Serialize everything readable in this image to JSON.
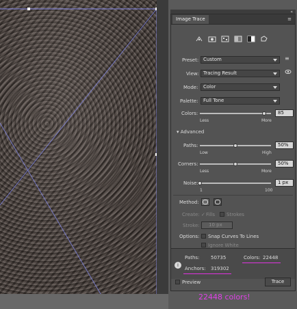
{
  "panel": {
    "tab_title": "Image Trace",
    "collapse_glyph": "«",
    "menu_glyph": "≡",
    "preset_icons": [
      "auto-color-icon",
      "high-color-icon",
      "low-color-icon",
      "grayscale-icon",
      "black-white-icon",
      "outline-icon"
    ]
  },
  "preset": {
    "label": "Preset:",
    "value": "Custom"
  },
  "view": {
    "label": "View:",
    "value": "Tracing Result"
  },
  "mode": {
    "label": "Mode:",
    "value": "Color"
  },
  "palette": {
    "label": "Palette:",
    "value": "Full Tone"
  },
  "colors": {
    "label": "Colors:",
    "value": "85",
    "min_label": "Less",
    "max_label": "More",
    "level": 0.9
  },
  "advanced": {
    "label": "Advanced"
  },
  "paths": {
    "label": "Paths:",
    "value": "50%",
    "min_label": "Low",
    "max_label": "High",
    "level": 0.5
  },
  "corners": {
    "label": "Corners:",
    "value": "50%",
    "min_label": "Less",
    "max_label": "More",
    "level": 0.5
  },
  "noise": {
    "label": "Noise:",
    "value": "1 px",
    "min_label": "1",
    "max_label": "100",
    "level": 0.0
  },
  "method": {
    "label": "Method:"
  },
  "create": {
    "label": "Create:",
    "fills": "Fills",
    "strokes": "Strokes"
  },
  "stroke": {
    "label": "Stroke:",
    "value": "10 px"
  },
  "options": {
    "label": "Options:",
    "snap": "Snap Curves To Lines",
    "ignore_white": "Ignore White"
  },
  "stats": {
    "paths_label": "Paths:",
    "paths_value": "50735",
    "anchors_label": "Anchors:",
    "anchors_value": "319302",
    "colors_label": "Colors:",
    "colors_value": "22448"
  },
  "footer": {
    "preview": "Preview",
    "trace": "Trace"
  },
  "caption": "22448 colors!",
  "accent_color": "#e040e8"
}
